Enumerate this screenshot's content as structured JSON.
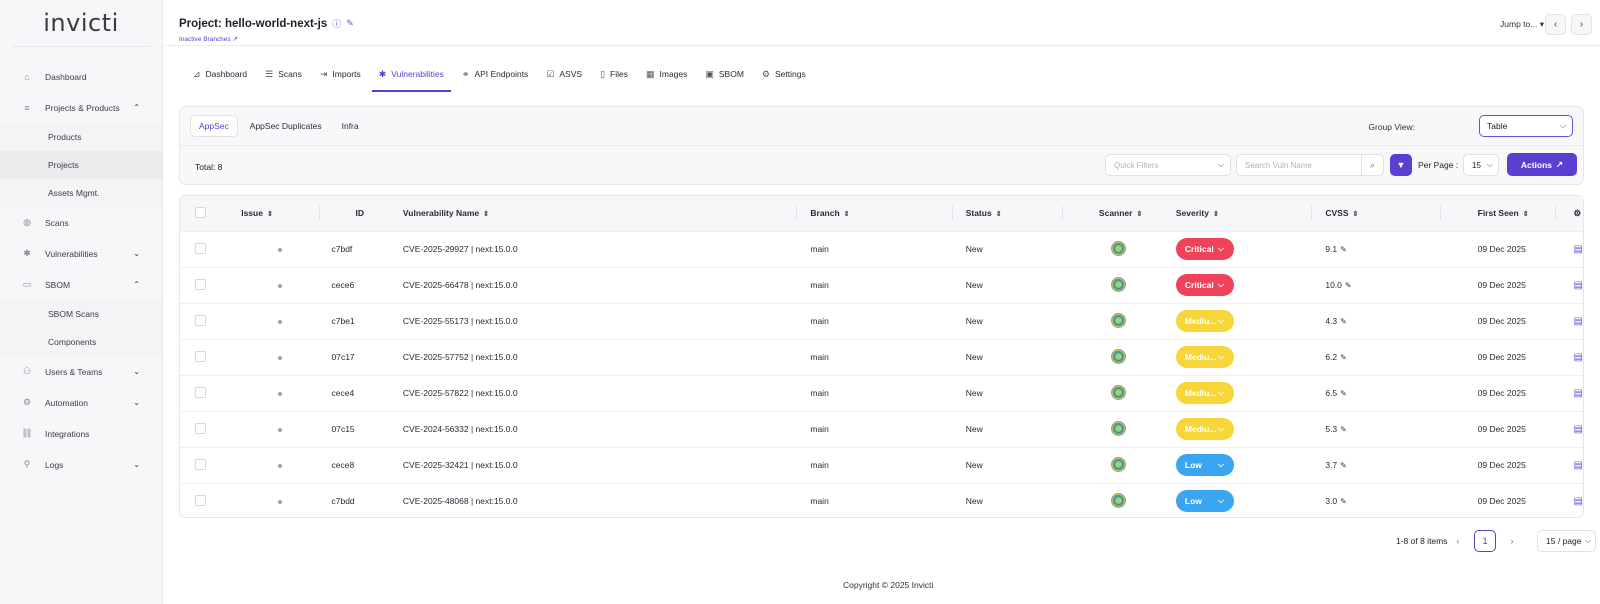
{
  "app": {
    "logo": "invicti"
  },
  "sidebar": {
    "items": [
      {
        "label": "Dashboard",
        "icon": "home-icon"
      },
      {
        "label": "Projects & Products",
        "icon": "list-icon",
        "expanded": true,
        "children": [
          "Products",
          "Projects",
          "Assets Mgmt."
        ]
      },
      {
        "label": "Scans",
        "icon": "scan-icon"
      },
      {
        "label": "Vulnerabilities",
        "icon": "bug-icon",
        "collapsed": true
      },
      {
        "label": "SBOM",
        "icon": "file-icon",
        "expanded": true,
        "children": [
          "SBOM Scans",
          "Components"
        ]
      },
      {
        "label": "Users & Teams",
        "icon": "users-icon",
        "collapsed": true
      },
      {
        "label": "Automation",
        "icon": "automation-icon",
        "collapsed": true
      },
      {
        "label": "Integrations",
        "icon": "integrations-icon"
      },
      {
        "label": "Logs",
        "icon": "logs-icon",
        "collapsed": true
      }
    ],
    "active_child": "Projects"
  },
  "header": {
    "title": "Project: hello-world-next-js",
    "inactive_branches": "Inactive Branches",
    "jump_to": "Jump to...",
    "prev": "‹",
    "next": "›"
  },
  "tabs": [
    {
      "label": "Dashboard",
      "icon": "chart-icon"
    },
    {
      "label": "Scans",
      "icon": "scans-icon"
    },
    {
      "label": "Imports",
      "icon": "import-icon"
    },
    {
      "label": "Vulnerabilities",
      "icon": "bug-icon",
      "active": true
    },
    {
      "label": "API Endpoints",
      "icon": "api-icon"
    },
    {
      "label": "ASVS",
      "icon": "checkbox-icon"
    },
    {
      "label": "Files",
      "icon": "files-icon"
    },
    {
      "label": "Images",
      "icon": "images-icon"
    },
    {
      "label": "SBOM",
      "icon": "sbom-icon"
    },
    {
      "label": "Settings",
      "icon": "gear-icon"
    }
  ],
  "subtabs": [
    "AppSec",
    "AppSec Duplicates",
    "Infra"
  ],
  "group_view": {
    "label": "Group View:",
    "value": "Table"
  },
  "toolbar": {
    "total": "Total: 8",
    "quick_filters_placeholder": "Quick Filters",
    "search_placeholder": "Search Vuln Name",
    "per_page_label": "Per Page :",
    "per_page_value": "15",
    "actions_label": "Actions"
  },
  "table": {
    "columns": [
      "Issue",
      "ID",
      "Vulnerability Name",
      "Branch",
      "Status",
      "Scanner",
      "Severity",
      "CVSS",
      "First Seen"
    ],
    "rows": [
      {
        "id": "c7bdf",
        "name": "CVE-2025-29927 | next:15.0.0",
        "branch": "main",
        "status": "New",
        "severity": "Critical",
        "cvss": "9.1",
        "first_seen": "09 Dec 2025"
      },
      {
        "id": "cece6",
        "name": "CVE-2025-66478 | next:15.0.0",
        "branch": "main",
        "status": "New",
        "severity": "Critical",
        "cvss": "10.0",
        "first_seen": "09 Dec 2025"
      },
      {
        "id": "c7be1",
        "name": "CVE-2025-55173 | next:15.0.0",
        "branch": "main",
        "status": "New",
        "severity": "Mediu...",
        "cvss": "4.3",
        "first_seen": "09 Dec 2025"
      },
      {
        "id": "07c17",
        "name": "CVE-2025-57752 | next:15.0.0",
        "branch": "main",
        "status": "New",
        "severity": "Mediu...",
        "cvss": "6.2",
        "first_seen": "09 Dec 2025"
      },
      {
        "id": "cece4",
        "name": "CVE-2025-57822 | next:15.0.0",
        "branch": "main",
        "status": "New",
        "severity": "Mediu...",
        "cvss": "6.5",
        "first_seen": "09 Dec 2025"
      },
      {
        "id": "07c15",
        "name": "CVE-2024-56332 | next:15.0.0",
        "branch": "main",
        "status": "New",
        "severity": "Mediu...",
        "cvss": "5.3",
        "first_seen": "09 Dec 2025"
      },
      {
        "id": "cece8",
        "name": "CVE-2025-32421 | next:15.0.0",
        "branch": "main",
        "status": "New",
        "severity": "Low",
        "cvss": "3.7",
        "first_seen": "09 Dec 2025"
      },
      {
        "id": "c7bdd",
        "name": "CVE-2025-48068 | next:15.0.0",
        "branch": "main",
        "status": "New",
        "severity": "Low",
        "cvss": "3.0",
        "first_seen": "09 Dec 2025"
      }
    ]
  },
  "severity_colors": {
    "Critical": "#f0435a",
    "Mediu...": "#f7d63a",
    "Low": "#3aa6f2"
  },
  "pagination": {
    "info": "1-8 of 8 items",
    "current": "1",
    "page_size": "15 / page"
  },
  "footer": {
    "copyright": "Copyright © 2025 Invicti"
  }
}
